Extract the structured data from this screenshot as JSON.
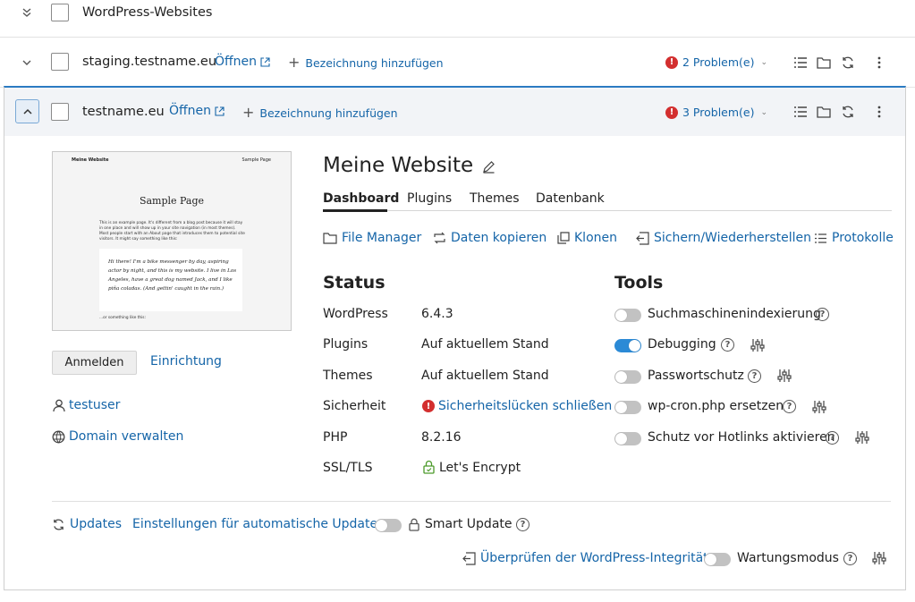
{
  "group_row": {
    "title": "WordPress-Websites"
  },
  "staging_row": {
    "name": "staging.testname.eu",
    "open_label": "Öffnen",
    "add_label": "Bezeichnung hinzufügen",
    "problems": "2 Problem(e)"
  },
  "main_row": {
    "name": "testname.eu",
    "open_label": "Öffnen",
    "add_label": "Bezeichnung hinzufügen",
    "problems": "3 Problem(e)"
  },
  "preview": {
    "site_title": "Meine Website",
    "nav": "Sample Page",
    "heading": "Sample Page",
    "para1": "This is an example page. It's different from a blog post because it will stay in one place and will show up in your site navigation (in most themes). Most people start with an About page that introduces them to potential site visitors. It might say something like this:",
    "quote": "Hi there! I'm a bike messenger by day, aspiring actor by night, and this is my website. I live in Los Angeles, have a great dog named Jack, and I like piña coladas. (And gettin' caught in the rain.)",
    "para2": "...or something like this:"
  },
  "left": {
    "login_button": "Anmelden",
    "setup_link": "Einrichtung",
    "user": "testuser",
    "domain_link": "Domain verwalten"
  },
  "detail": {
    "title": "Meine Website",
    "tabs": [
      "Dashboard",
      "Plugins",
      "Themes",
      "Datenbank"
    ],
    "actions": [
      "File Manager",
      "Daten kopieren",
      "Klonen",
      "Sichern/Wiederherstellen",
      "Protokolle"
    ]
  },
  "status": {
    "title": "Status",
    "rows": [
      {
        "label": "WordPress",
        "value": "6.4.3"
      },
      {
        "label": "Plugins",
        "value": "Auf aktuellem Stand"
      },
      {
        "label": "Themes",
        "value": "Auf aktuellem Stand"
      },
      {
        "label": "Sicherheit",
        "value": "Sicherheitslücken schließen"
      },
      {
        "label": "PHP",
        "value": "8.2.16"
      },
      {
        "label": "SSL/TLS",
        "value": "Let's Encrypt"
      }
    ]
  },
  "tools": {
    "title": "Tools",
    "items": [
      {
        "label": "Suchmaschinenindexierung",
        "on": false
      },
      {
        "label": "Debugging",
        "on": true
      },
      {
        "label": "Passwortschutz",
        "on": false
      },
      {
        "label": "wp-cron.php ersetzen",
        "on": false
      },
      {
        "label": "Schutz vor Hotlinks aktivieren",
        "on": false
      }
    ]
  },
  "bottom": {
    "updates": "Updates",
    "auto_updates": "Einstellungen für automatische Updates",
    "smart_update": "Smart Update",
    "integrity": "Überprüfen der WordPress-Integrität",
    "maintenance": "Wartungsmodus"
  },
  "colors": {
    "accent": "#1565a8",
    "toggle_on": "#2b8ad6",
    "error": "#d32f2f",
    "panel_border": "#2b7bc2"
  }
}
